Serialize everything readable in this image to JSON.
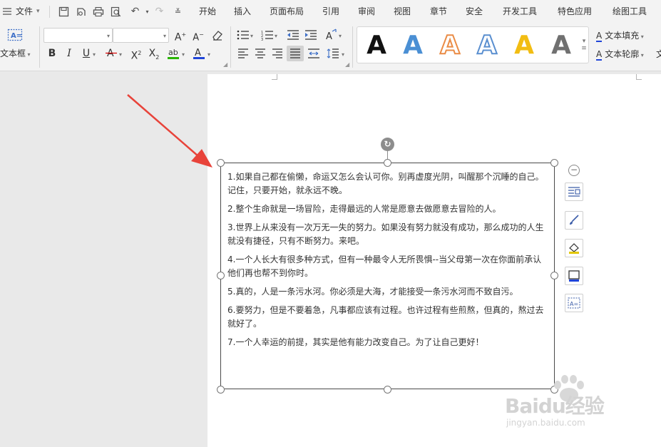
{
  "menu": {
    "file_label": "文件",
    "tabs": [
      "开始",
      "插入",
      "页面布局",
      "引用",
      "审阅",
      "视图",
      "章节",
      "安全",
      "开发工具",
      "特色应用",
      "绘图工具"
    ]
  },
  "ribbon": {
    "textbox_label": "文本框",
    "style_letter": "A",
    "style_colors": [
      "#111111",
      "#4a8fd4",
      "#ea8c46",
      "#5a8fd0",
      "#f2bd12",
      "#707070"
    ],
    "text_fill_label": "文本填充",
    "text_outline_label": "文本轮廓",
    "text_effect_glyph": "文",
    "font_color": "#d80000",
    "highlight_color": "#29b400",
    "underline_color": "#1f44d8"
  },
  "document": {
    "paragraphs": [
      "1.如果自己都在偷懒，命运又怎么会认可你。别再虚度光阴，叫醒那个沉睡的自己。记住，只要开始，就永远不晚。",
      "2.整个生命就是一场冒险，走得最远的人常是愿意去做愿意去冒险的人。",
      "3.世界上从来没有一次万无一失的努力。如果没有努力就没有成功，那么成功的人生就没有捷径，只有不断努力。来吧。",
      "4.一个人长大有很多种方式，但有一种最令人无所畏惧--当父母第一次在你面前承认他们再也帮不到你时。",
      "5.真的，人是一条污水河。你必须是大海，才能接受一条污水河而不致自污。",
      "6.要努力，但是不要着急，凡事都应该有过程。也许过程有些煎熬，但真的，熬过去就好了。",
      "7.一个人幸运的前提，其实是他有能力改变自己。为了让自己更好！"
    ]
  },
  "annotation": {
    "arrow_color": "#e8433a"
  },
  "watermark": {
    "brand": "Baidu经验",
    "url": "jingyan.baidu.com"
  }
}
